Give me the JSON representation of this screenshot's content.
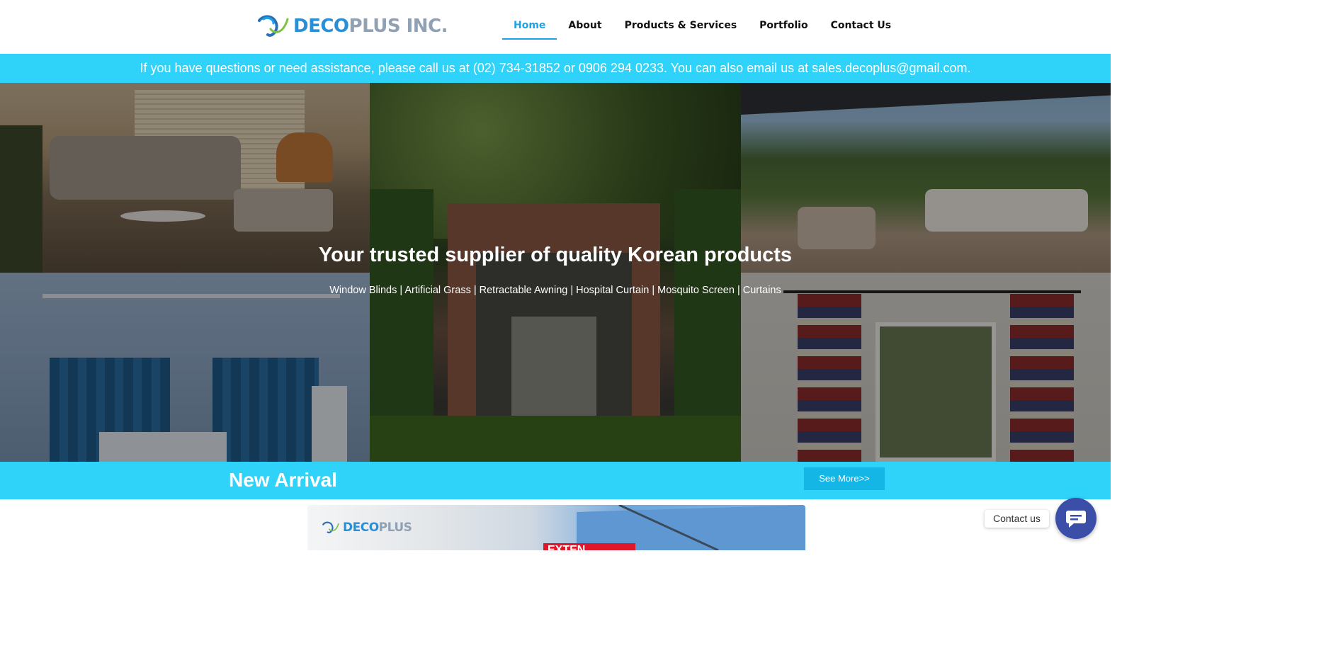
{
  "header": {
    "logo_text_primary": "DECO",
    "logo_text_secondary": "PLUS INC.",
    "nav": [
      {
        "label": "Home",
        "active": true
      },
      {
        "label": "About",
        "active": false
      },
      {
        "label": "Products & Services",
        "active": false
      },
      {
        "label": "Portfolio",
        "active": false
      },
      {
        "label": "Contact Us",
        "active": false
      }
    ]
  },
  "info_bar": {
    "text": "If you have questions or need assistance, please call us at (02) 734-31852 or 0906 294 0233. You can also email us at sales.decoplus@gmail.com."
  },
  "hero": {
    "title": "Your trusted supplier of quality Korean products",
    "subtitle": "Window Blinds | Artificial Grass | Retractable Awning | Hospital Curtain | Mosquito Screen | Curtains"
  },
  "new_arrival": {
    "title": "New Arrival",
    "see_more_label": "See More>>"
  },
  "banner": {
    "logo_primary": "DECO",
    "logo_secondary": "PLUS",
    "red_text": "EXTEN"
  },
  "contact_widget": {
    "label": "Contact us",
    "icon": "chat-icon"
  },
  "colors": {
    "accent": "#2fd2f9",
    "nav_active": "#1aa3e8",
    "button": "#14b6e6",
    "contact_button": "#3b4fa8"
  }
}
